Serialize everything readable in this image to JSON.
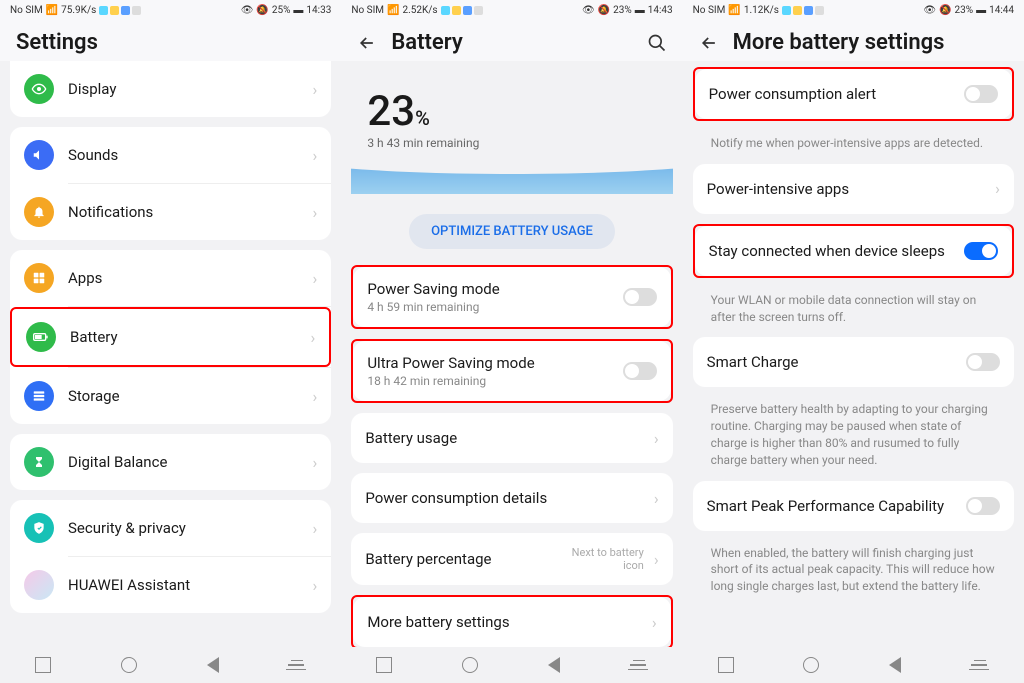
{
  "screen1": {
    "status": {
      "carrier": "No SIM",
      "speed": "75.9K/s",
      "battery": "25%",
      "time": "14:33"
    },
    "title": "Settings",
    "items": [
      {
        "label": "Display",
        "icon": "eye",
        "color": "#2fbb4a"
      },
      {
        "label": "Sounds",
        "icon": "sound",
        "color": "#3b6cf5"
      },
      {
        "label": "Notifications",
        "icon": "bell",
        "color": "#f5a623"
      },
      {
        "label": "Apps",
        "icon": "apps",
        "color": "#f5a623"
      },
      {
        "label": "Battery",
        "icon": "battery",
        "color": "#2fbb4a",
        "highlight": true
      },
      {
        "label": "Storage",
        "icon": "storage",
        "color": "#2f6ff5"
      },
      {
        "label": "Digital Balance",
        "icon": "hourglass",
        "color": "#2fc06e"
      },
      {
        "label": "Security & privacy",
        "icon": "shield",
        "color": "#17c1b6"
      },
      {
        "label": "HUAWEI Assistant",
        "icon": "assistant",
        "color": "#e8c9f0"
      }
    ]
  },
  "screen2": {
    "status": {
      "carrier": "No SIM",
      "speed": "2.52K/s",
      "battery": "23%",
      "time": "14:43"
    },
    "title": "Battery",
    "percentage": "23",
    "pct_symbol": "%",
    "remaining": "3 h 43 min remaining",
    "optimize_btn": "OPTIMIZE BATTERY USAGE",
    "rows": [
      {
        "label": "Power Saving mode",
        "sub": "4 h 59 min remaining",
        "type": "toggle",
        "highlight": true
      },
      {
        "label": "Ultra Power Saving mode",
        "sub": "18 h 42 min remaining",
        "type": "toggle",
        "highlight": true
      },
      {
        "label": "Battery usage",
        "type": "chevron"
      },
      {
        "label": "Power consumption details",
        "type": "chevron"
      },
      {
        "label": "Battery percentage",
        "meta": "Next to battery icon",
        "type": "chevron"
      },
      {
        "label": "More battery settings",
        "type": "chevron",
        "highlight": true
      }
    ]
  },
  "screen3": {
    "status": {
      "carrier": "No SIM",
      "speed": "1.12K/s",
      "battery": "23%",
      "time": "14:44"
    },
    "title": "More battery settings",
    "rows": [
      {
        "label": "Power consumption alert",
        "type": "toggle",
        "on": false,
        "highlight": true,
        "desc": "Notify me when power-intensive apps are detected."
      },
      {
        "label": "Power-intensive apps",
        "type": "chevron"
      },
      {
        "label": "Stay connected when device sleeps",
        "type": "toggle",
        "on": true,
        "highlight": true,
        "desc": "Your WLAN or mobile data connection will stay on after the screen turns off."
      },
      {
        "label": "Smart Charge",
        "type": "toggle",
        "on": false,
        "desc": "Preserve battery health by adapting to your charging routine. Charging may be paused when state of charge is higher than 80% and rusumed to fully charge battery when your need."
      },
      {
        "label": "Smart Peak Performance Capability",
        "type": "toggle",
        "on": false,
        "desc": "When enabled, the battery will finish charging just short of its actual peak capacity. This will reduce how long single charges last, but extend the battery life."
      }
    ]
  }
}
